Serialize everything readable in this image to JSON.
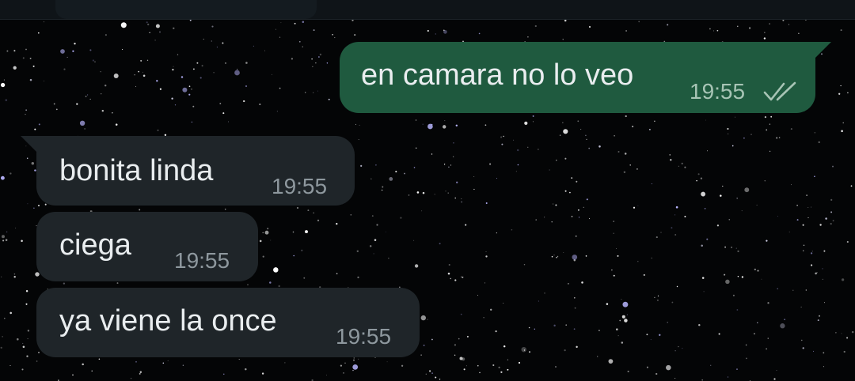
{
  "chat": {
    "messages": [
      {
        "direction": "outgoing",
        "text": "en camara no lo veo",
        "time": "19:55",
        "status_icon": "double-check-icon"
      },
      {
        "direction": "incoming",
        "text": "bonita linda",
        "time": "19:55"
      },
      {
        "direction": "incoming",
        "text": "ciega",
        "time": "19:55"
      },
      {
        "direction": "incoming",
        "text": "ya viene la once",
        "time": "19:55"
      }
    ]
  },
  "colors": {
    "wallpaper": "#040506",
    "outgoing_bubble": "#1f5a3f",
    "incoming_bubble": "#1f2529",
    "message_text": "#e9edef",
    "outgoing_meta": "#a7c4b5",
    "incoming_meta": "#8e989e"
  }
}
